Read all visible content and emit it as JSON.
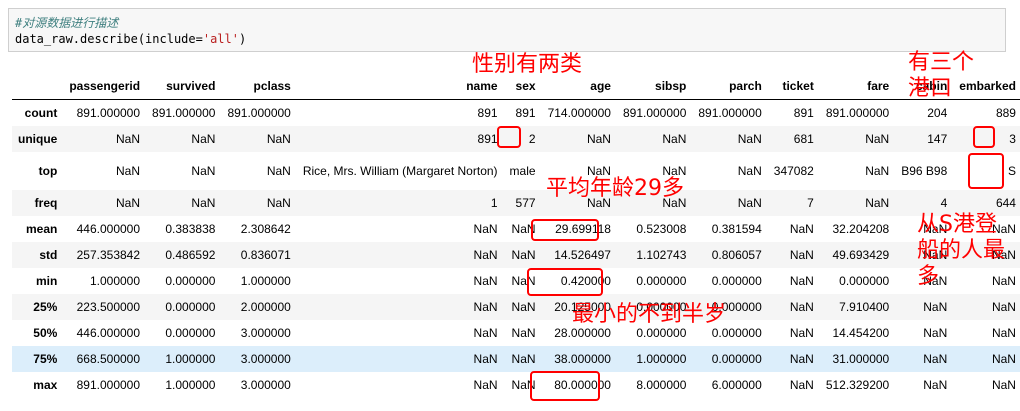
{
  "code": {
    "comment": "#对源数据进行描述",
    "line_prefix": "data_raw.describe(include=",
    "line_arg": "'all'",
    "line_suffix": ")"
  },
  "table": {
    "columns": [
      "passengerid",
      "survived",
      "pclass",
      "name",
      "sex",
      "age",
      "sibsp",
      "parch",
      "ticket",
      "fare",
      "cabin",
      "embarked"
    ],
    "rows": [
      {
        "label": "count",
        "cells": [
          "891.000000",
          "891.000000",
          "891.000000",
          "891",
          "891",
          "714.000000",
          "891.000000",
          "891.000000",
          "891",
          "891.000000",
          "204",
          "889"
        ]
      },
      {
        "label": "unique",
        "cells": [
          "NaN",
          "NaN",
          "NaN",
          "891",
          "2",
          "NaN",
          "NaN",
          "NaN",
          "681",
          "NaN",
          "147",
          "3"
        ]
      },
      {
        "label": "top",
        "cells": [
          "NaN",
          "NaN",
          "NaN",
          "Rice, Mrs. William (Margaret Norton)",
          "male",
          "NaN",
          "NaN",
          "NaN",
          "347082",
          "NaN",
          "B96 B98",
          "S"
        ]
      },
      {
        "label": "freq",
        "cells": [
          "NaN",
          "NaN",
          "NaN",
          "1",
          "577",
          "NaN",
          "NaN",
          "NaN",
          "7",
          "NaN",
          "4",
          "644"
        ]
      },
      {
        "label": "mean",
        "cells": [
          "446.000000",
          "0.383838",
          "2.308642",
          "NaN",
          "NaN",
          "29.699118",
          "0.523008",
          "0.381594",
          "NaN",
          "32.204208",
          "NaN",
          "NaN"
        ]
      },
      {
        "label": "std",
        "cells": [
          "257.353842",
          "0.486592",
          "0.836071",
          "NaN",
          "NaN",
          "14.526497",
          "1.102743",
          "0.806057",
          "NaN",
          "49.693429",
          "NaN",
          "NaN"
        ]
      },
      {
        "label": "min",
        "cells": [
          "1.000000",
          "0.000000",
          "1.000000",
          "NaN",
          "NaN",
          "0.420000",
          "0.000000",
          "0.000000",
          "NaN",
          "0.000000",
          "NaN",
          "NaN"
        ]
      },
      {
        "label": "25%",
        "cells": [
          "223.500000",
          "0.000000",
          "2.000000",
          "NaN",
          "NaN",
          "20.125000",
          "0.000000",
          "0.000000",
          "NaN",
          "7.910400",
          "NaN",
          "NaN"
        ]
      },
      {
        "label": "50%",
        "cells": [
          "446.000000",
          "0.000000",
          "3.000000",
          "NaN",
          "NaN",
          "28.000000",
          "0.000000",
          "0.000000",
          "NaN",
          "14.454200",
          "NaN",
          "NaN"
        ]
      },
      {
        "label": "75%",
        "cells": [
          "668.500000",
          "1.000000",
          "3.000000",
          "NaN",
          "NaN",
          "38.000000",
          "1.000000",
          "0.000000",
          "NaN",
          "31.000000",
          "NaN",
          "NaN"
        ]
      },
      {
        "label": "max",
        "cells": [
          "891.000000",
          "1.000000",
          "3.000000",
          "NaN",
          "NaN",
          "80.000000",
          "8.000000",
          "6.000000",
          "NaN",
          "512.329200",
          "NaN",
          "NaN"
        ]
      }
    ]
  },
  "annotations": {
    "sex_two_types": "性别有两类",
    "three_ports": "有三个港口",
    "mean_age": "平均年龄29多",
    "most_from_s": "从S港登船的人最多",
    "min_under_half": "最小的不到半岁"
  },
  "colors": {
    "annotation": "#ff0000",
    "hover_row": "#dceefb",
    "striped_row": "#f5f5f5"
  }
}
